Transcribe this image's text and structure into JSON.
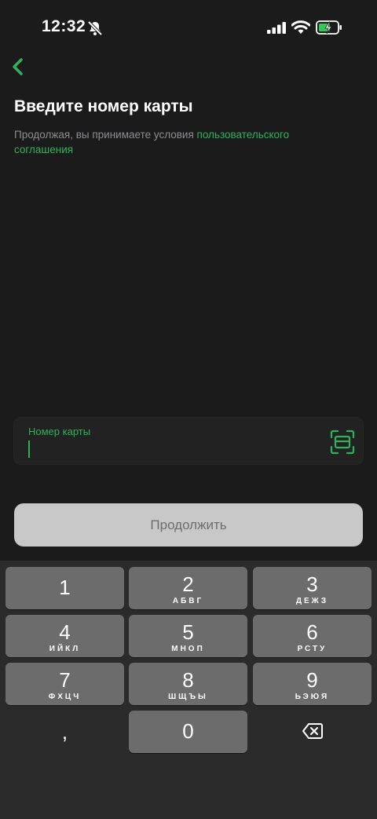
{
  "status_bar": {
    "time": "12:32",
    "icons": [
      "bell-muted-icon",
      "cellular-signal-icon",
      "wifi-icon",
      "battery-charging-icon"
    ]
  },
  "nav": {
    "back_icon": "chevron-left-icon"
  },
  "page": {
    "title": "Введите номер карты",
    "terms_prefix": "Продолжая, вы принимаете условия ",
    "terms_link": "пользовательского соглашения"
  },
  "card_field": {
    "label": "Номер карты",
    "value": "",
    "scan_icon": "card-scan-icon"
  },
  "continue_button": {
    "label": "Продолжить"
  },
  "keyboard": {
    "keys": [
      {
        "digit": "1",
        "letters": ""
      },
      {
        "digit": "2",
        "letters": "АБВГ"
      },
      {
        "digit": "3",
        "letters": "ДЕЖЗ"
      },
      {
        "digit": "4",
        "letters": "ИЙКЛ"
      },
      {
        "digit": "5",
        "letters": "МНОП"
      },
      {
        "digit": "6",
        "letters": "РСТУ"
      },
      {
        "digit": "7",
        "letters": "ФХЦЧ"
      },
      {
        "digit": "8",
        "letters": "ШЩЪЫ"
      },
      {
        "digit": "9",
        "letters": "ЬЭЮЯ"
      },
      {
        "digit": "0",
        "letters": ""
      }
    ],
    "comma": ",",
    "delete_icon": "backspace-icon"
  },
  "colors": {
    "accent": "#31b25a",
    "background": "#1b1b1b",
    "key": "#6c6c6c",
    "button": "#c8c8c8"
  }
}
